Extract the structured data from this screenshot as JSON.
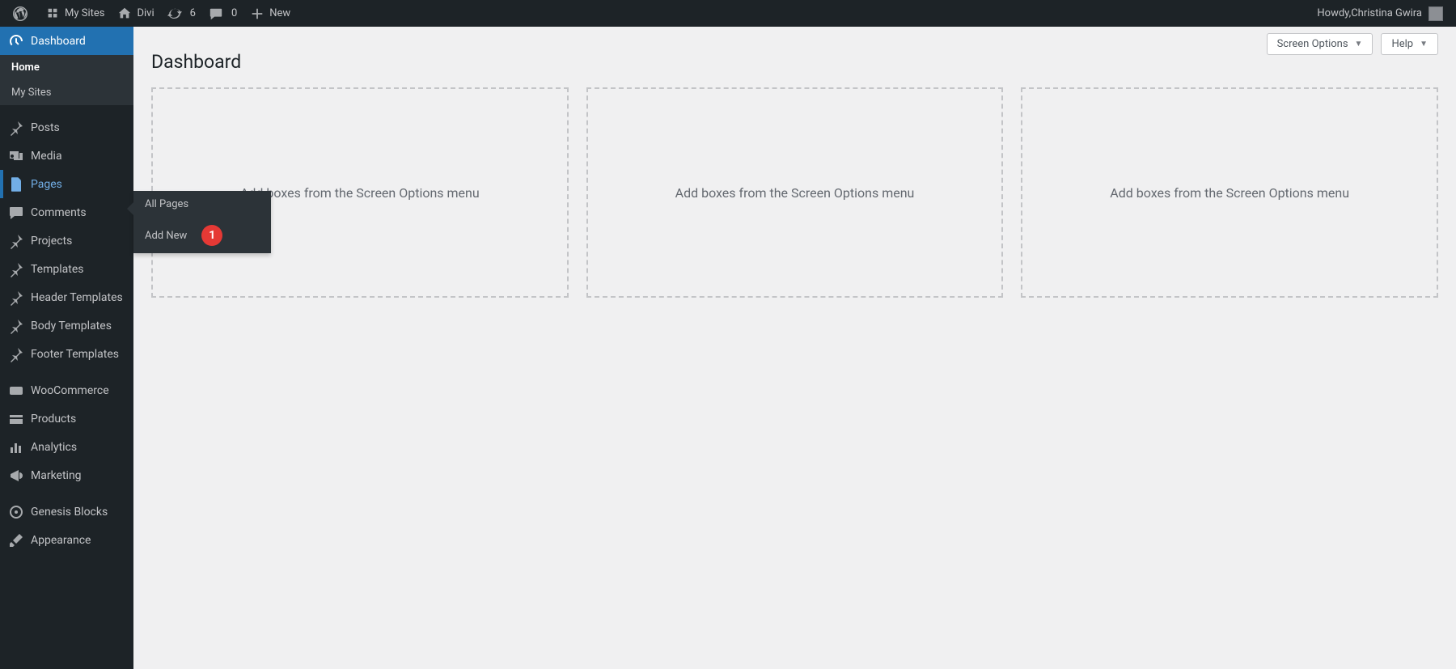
{
  "adminbar": {
    "my_sites": "My Sites",
    "site_name": "Divi",
    "updates_count": "6",
    "comments_count": "0",
    "new": "New",
    "howdy_prefix": "Howdy, ",
    "user_name": "Christina Gwira"
  },
  "sidebar": {
    "items": [
      {
        "id": "dashboard",
        "label": "Dashboard",
        "icon": "gauge",
        "current": true
      },
      {
        "id": "posts",
        "label": "Posts",
        "icon": "pin"
      },
      {
        "id": "media",
        "label": "Media",
        "icon": "media"
      },
      {
        "id": "pages",
        "label": "Pages",
        "icon": "page",
        "pages_active": true
      },
      {
        "id": "comments",
        "label": "Comments",
        "icon": "comment"
      },
      {
        "id": "projects",
        "label": "Projects",
        "icon": "pin"
      },
      {
        "id": "templates",
        "label": "Templates",
        "icon": "pin"
      },
      {
        "id": "header-templates",
        "label": "Header Templates",
        "icon": "pin"
      },
      {
        "id": "body-templates",
        "label": "Body Templates",
        "icon": "pin"
      },
      {
        "id": "footer-templates",
        "label": "Footer Templates",
        "icon": "pin"
      },
      {
        "id": "woocommerce",
        "label": "WooCommerce",
        "icon": "woo"
      },
      {
        "id": "products",
        "label": "Products",
        "icon": "products"
      },
      {
        "id": "analytics",
        "label": "Analytics",
        "icon": "analytics"
      },
      {
        "id": "marketing",
        "label": "Marketing",
        "icon": "marketing"
      },
      {
        "id": "genesis-blocks",
        "label": "Genesis Blocks",
        "icon": "genesis"
      },
      {
        "id": "appearance",
        "label": "Appearance",
        "icon": "appearance"
      }
    ],
    "dashboard_sub": {
      "home": "Home",
      "my_sites": "My Sites"
    }
  },
  "flyout": {
    "all_pages": "All Pages",
    "add_new": "Add New",
    "badge": "1"
  },
  "content": {
    "title": "Dashboard",
    "screen_options": "Screen Options",
    "help": "Help",
    "placeholder": "Add boxes from the Screen Options menu"
  }
}
